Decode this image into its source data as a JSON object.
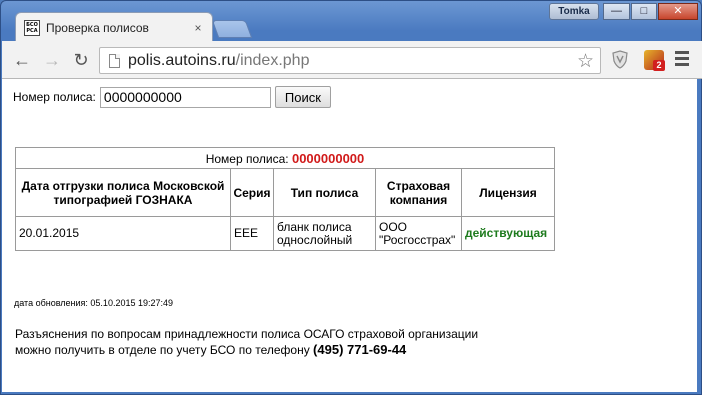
{
  "window": {
    "user": "Tomka",
    "minimize": "—",
    "maximize": "□",
    "close": "✕"
  },
  "tab": {
    "favicon_line1": "БСО",
    "favicon_line2": "РСА",
    "title": "Проверка полисов",
    "close": "×"
  },
  "toolbar": {
    "back": "←",
    "forward": "→",
    "reload": "↻",
    "url_host": "polis.autoins.ru",
    "url_path": "/index.php",
    "star": "☆",
    "extension_badge": "2"
  },
  "search": {
    "label": "Номер полиса:",
    "value": "0000000000",
    "button": "Поиск"
  },
  "result": {
    "caption_label": "Номер полиса:",
    "caption_number": "0000000000",
    "headers": {
      "date": "Дата отгрузки полиса Московской типографией ГОЗНАКА",
      "series": "Серия",
      "type": "Тип полиса",
      "company": "Страховая компания",
      "license": "Лицензия"
    },
    "row": {
      "date": "20.01.2015",
      "series": "ЕЕЕ",
      "type": "бланк полиса однослойный",
      "company": "ООО \"Росгосстрах\"",
      "license": "действующая"
    }
  },
  "update": "дата обновления: 05.10.2015 19:27:49",
  "note": {
    "line1": "Разъяснения по вопросам принадлежности полиса ОСАГО страховой организации",
    "line2": "можно получить в отделе по учету БСО по телефону",
    "phone": "(495) 771-69-44"
  },
  "colors": {
    "frame": "#4a7ac0",
    "policy_number": "#d11a1a",
    "license_valid": "#1e7b1e"
  }
}
